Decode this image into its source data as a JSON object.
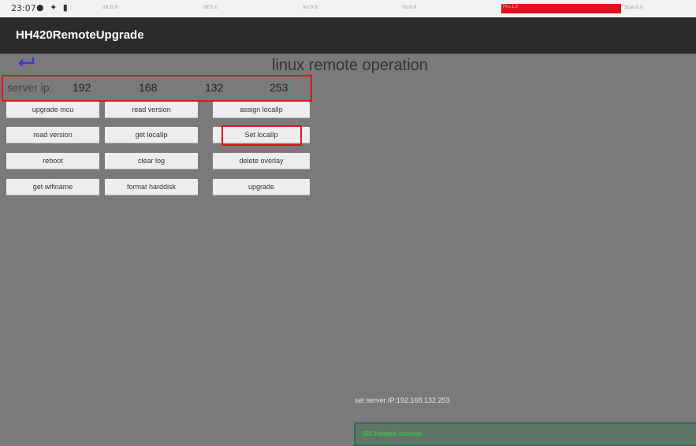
{
  "status_bar": {
    "time": "23:07",
    "metrics": [
      "dX:0.0",
      "dY:0.0",
      "Xv:0.0",
      "Yv:0.0",
      "Prs:1.0",
      "Size:0.0"
    ],
    "pressure_color": "#e01020"
  },
  "app": {
    "title": "HH420RemoteUpgrade"
  },
  "page": {
    "back_icon": "back-arrow-icon",
    "title": "linux remote operation"
  },
  "server_ip": {
    "label": "server ip:",
    "octets": [
      "192",
      "168",
      "132",
      "253"
    ]
  },
  "buttons": [
    "upgrade mcu",
    "read version",
    "assign localIp",
    "read version",
    "get localIp",
    "Set localIp",
    "reboot",
    "clear log",
    "delete overlay",
    "get wifiname",
    "format harddisk",
    "upgrade"
  ],
  "highlight_color": "#e0151c",
  "log": {
    "message": "set server IP:192.168.132.253",
    "result": "SBOnetwork success"
  }
}
